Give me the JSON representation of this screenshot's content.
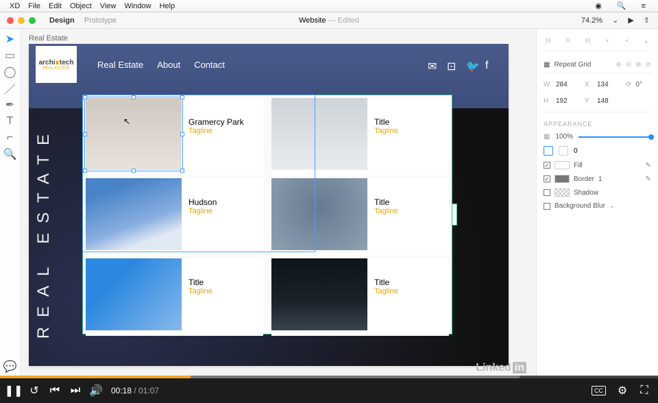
{
  "mac_menu": {
    "app": "XD",
    "items": [
      "File",
      "Edit",
      "Object",
      "View",
      "Window",
      "Help"
    ]
  },
  "app_tabs": {
    "design": "Design",
    "prototype": "Prototype"
  },
  "doc": {
    "title": "Website",
    "status": "— Edited",
    "zoom": "74.2%"
  },
  "artboard": {
    "label": "Real Estate",
    "side_text": "REAL ESTATE"
  },
  "logo": {
    "line1": "archi",
    "line2": "tech",
    "sub": "REAL ESTATE"
  },
  "nav": {
    "items": [
      "Real Estate",
      "About",
      "Contact"
    ]
  },
  "cards": [
    {
      "title": "Gramercy Park",
      "tag": "Tagline"
    },
    {
      "title": "Title",
      "tag": "Tagline"
    },
    {
      "title": "Hudson",
      "tag": "Tagline"
    },
    {
      "title": "Title",
      "tag": "Tagline"
    },
    {
      "title": "Title",
      "tag": "Tagline"
    },
    {
      "title": "Title",
      "tag": "Tagline"
    }
  ],
  "inspector": {
    "repeat_grid": "Repeat Grid",
    "w_label": "W",
    "w": "284",
    "x_label": "X",
    "x": "134",
    "rot": "0°",
    "h_label": "H",
    "h": "192",
    "y_label": "Y",
    "y": "148",
    "appearance": "APPEARANCE",
    "opacity": "100%",
    "corner": "0",
    "fill": "Fill",
    "border": "Border",
    "border_w": "1",
    "shadow": "Shadow",
    "blur": "Background Blur"
  },
  "watermark": "Linked",
  "watermark_box": "in",
  "video": {
    "current": "00:18",
    "duration": "01:07"
  }
}
